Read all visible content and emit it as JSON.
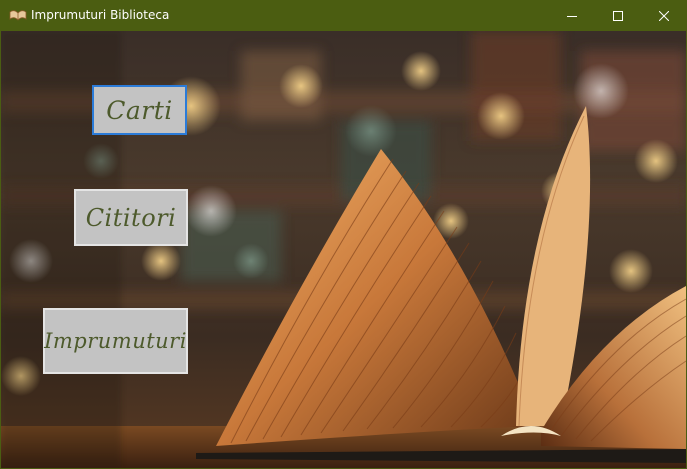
{
  "window": {
    "title": "Imprumuturi Biblioteca",
    "titlebar_color": "#4b5d11",
    "app_icon": "open-book-icon",
    "controls": {
      "minimize_icon": "minimize-icon",
      "maximize_icon": "maximize-icon",
      "close_icon": "close-icon"
    }
  },
  "background": {
    "description_icon": "open-book-library-background"
  },
  "menu": {
    "carti_label": "Carti",
    "cititori_label": "Cititori",
    "imprumuturi_label": "Imprumuturi",
    "focused_item": "Carti",
    "focus_color": "#2b7bd8",
    "button_text_color": "#4d5a2c"
  }
}
